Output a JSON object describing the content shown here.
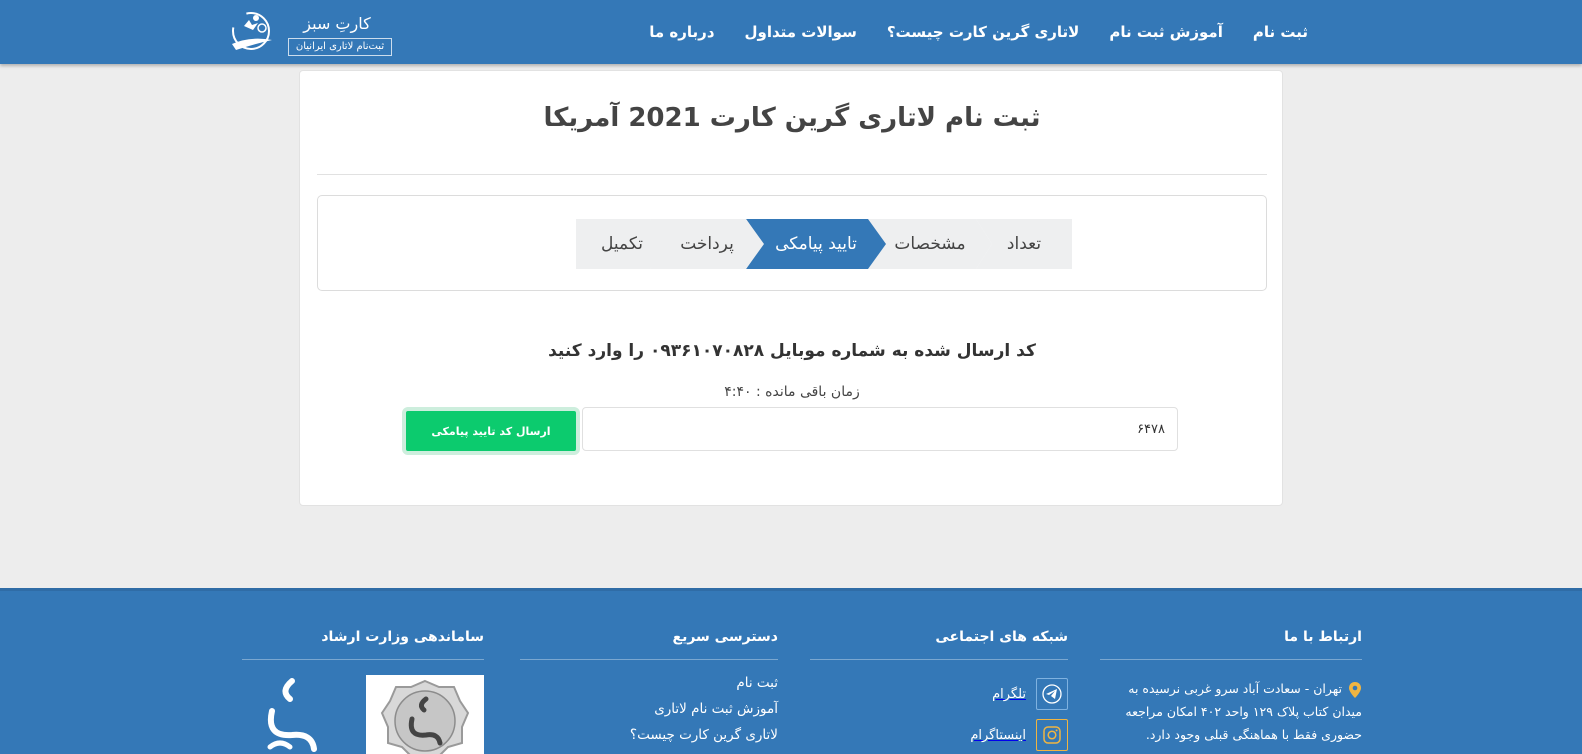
{
  "header": {
    "logo_title": "کارتِ سبز",
    "logo_subtitle": "ثبت‌نام لاتاری ایرانیان",
    "nav": [
      {
        "id": "register",
        "label": "ثبت نام"
      },
      {
        "id": "tutorial",
        "label": "آموزش ثبت نام"
      },
      {
        "id": "what-is",
        "label": "لاتاری گرین کارت چیست؟"
      },
      {
        "id": "faq",
        "label": "سوالات متداول"
      },
      {
        "id": "about",
        "label": "درباره ما"
      }
    ]
  },
  "main": {
    "title": "ثبت نام لاتاری گرین کارت 2021 آمریکا",
    "steps": [
      {
        "label": "تعداد",
        "state": "done"
      },
      {
        "label": "مشخصات",
        "state": "done"
      },
      {
        "label": "تایید پیامکی",
        "state": "active"
      },
      {
        "label": "پرداخت",
        "state": "pending"
      },
      {
        "label": "تکمیل",
        "state": "pending"
      }
    ],
    "code_prompt": "کد ارسال شده به شماره موبایل ۰۹۳۶۱۰۷۰۸۲۸ را وارد کنید",
    "timer": "زمان باقی مانده : ۴:۴۰",
    "code_value": "۶۴۷۸",
    "send_button": "ارسال کد تایید پیامکی"
  },
  "footer": {
    "contact": {
      "title": "ارتباط با ما",
      "address": "تهران - سعادت آباد سرو غربی نرسیده به میدان کتاب پلاک ۱۲۹ واحد ۴۰۲ امکان مراجعه حضوری فقط با هماهنگی قبلی وجود دارد."
    },
    "social": {
      "title": "شبکه های اجتماعی",
      "items": [
        {
          "label": "تلگرام",
          "icon": "telegram-icon"
        },
        {
          "label": "اینستاگرام",
          "icon": "instagram-icon"
        }
      ]
    },
    "quick": {
      "title": "دسترسی سریع",
      "links": [
        "ثبت نام",
        "آموزش ثبت نام لاتاری",
        "لاتاری گرین کارت چیست؟"
      ]
    },
    "ershad": {
      "title": "ساماندهی وزارت ارشاد"
    }
  },
  "colors": {
    "primary": "#3478b7",
    "success": "#0ccb6e",
    "step_inactive": "#eeeff0",
    "background": "#ededed"
  }
}
